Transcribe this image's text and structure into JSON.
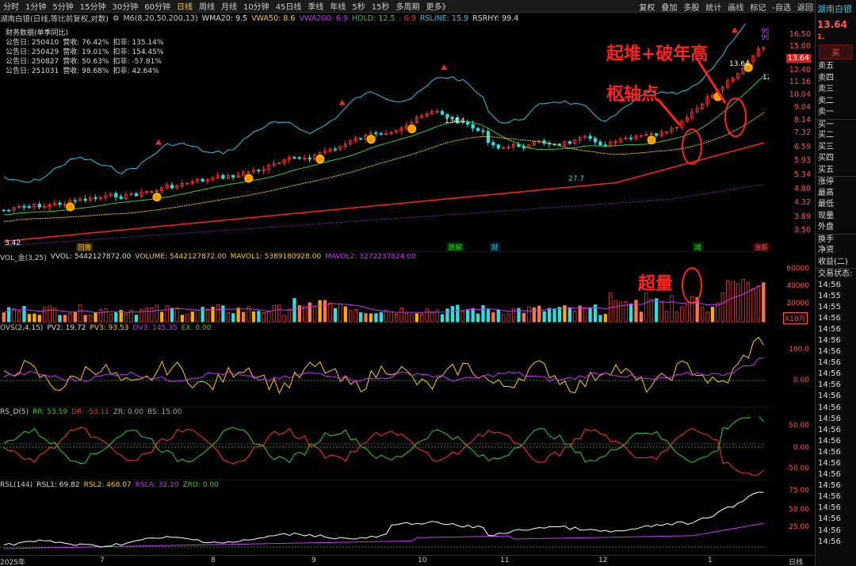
{
  "toolbar": {
    "periods": [
      "分时",
      "1分钟",
      "5分钟",
      "15分钟",
      "30分钟",
      "60分钟",
      "日线",
      "周线",
      "月线",
      "10分钟",
      "45日线",
      "季线",
      "年线",
      "5秒",
      "15秒",
      "多周期",
      "更多》"
    ],
    "active_period": "日线",
    "right_items": [
      "复权",
      "叠加",
      "多股",
      "统计",
      "画线",
      "标记",
      "-自选",
      "返回"
    ]
  },
  "info_line": {
    "title": "湖南白银(日线,等比前复权,对数)",
    "indicator": "M6(8,20,50,200,13)",
    "wma20": "WMA20: 9.5",
    "vwa50": "VWA50: 8.6",
    "vwa200": "VWA200: 6.9",
    "hold": "HOLD: 12.5",
    "hold_val2": ": 6.9",
    "rsline": "RSLINE: 15.9",
    "rsrhy": "RSRHY: 99.4"
  },
  "financial": {
    "header": "财务数据(单季同比)",
    "rows": [
      {
        "date": "公告日: 250410",
        "rev": "营收: 76.42%",
        "net": "扣非: 135.14%"
      },
      {
        "date": "公告日: 250429",
        "rev": "营收: 19.01%",
        "net": "扣非: 154.45%"
      },
      {
        "date": "公告日: 250827",
        "rev": "营收: 50.63%",
        "net": "扣非: -57.81%"
      },
      {
        "date": "公告日: 251031",
        "rev": "营收: 98.68%",
        "net": "扣非: 42.64%"
      }
    ]
  },
  "price_axis": [
    "16.50",
    "15.00",
    "13.64",
    "12.40",
    "11.16",
    "10.04",
    "9.04",
    "8.14",
    "7.32",
    "6.59",
    "5.93",
    "5.34",
    "4.80",
    "4.32",
    "3.89",
    "3.50"
  ],
  "price_labels": {
    "peak_top": "99.8",
    "peak_second": "99.4",
    "last_price": "13.64",
    "hold_level": "12.5",
    "low_label": "3.42",
    "mid_high": "134.4",
    "mid_low": "27.7"
  },
  "annotations": {
    "breakout": "起堆+破年高",
    "pivot": "枢轴点",
    "volume": "超量"
  },
  "event_tags": [
    "回撤",
    "跌解",
    "财",
    "减",
    "涨薪"
  ],
  "volume_panel": {
    "title": "VOL_金(3,25)",
    "vvol": "VVOL: 5442127872.00",
    "volume": "VOLUME: 5442127872.00",
    "mavol1": "MAVOL1: 5389180928.00",
    "mavol2": "MAVOL2: 3272237824.00",
    "axis": [
      "60000",
      "40000",
      "20000"
    ],
    "unit": "X10万"
  },
  "ovs_panel": {
    "title": "OVS(2,4,15)",
    "pv2": "PV2: 19.72",
    "pv3": "PV3: 93.53",
    "ov3": "OV3: 145.35",
    "ex": "EX: 0.00",
    "axis": [
      "100.0",
      "0.00"
    ]
  },
  "rsd_panel": {
    "title": "RS_D(5)",
    "rr": "RR: 53.59",
    "dr": "DR: -53.11",
    "zr": "ZR: 0.00",
    "bs": "BS: 15.00",
    "axis": [
      "50.00",
      "0.00",
      "-50.00"
    ]
  },
  "rsl_panel": {
    "title": "RSL(144)",
    "rsl1": "RSL1: 69.82",
    "rsl2": "RSL2: 468.07",
    "rsla": "RSLA: 32.10",
    "zro": "ZRO: 0.00",
    "axis": [
      "75.00",
      "50.00",
      "25.00"
    ]
  },
  "x_axis": [
    "2025年",
    "7",
    "8",
    "9",
    "10",
    "11",
    "12",
    "1",
    "日线"
  ],
  "right_panel": {
    "stock_name": "湖南白银",
    "price": "13.64",
    "price_suffix": "1.",
    "buy_label": "买",
    "order_rows": [
      "卖五",
      "卖四",
      "卖三",
      "卖二",
      "卖一",
      "买一",
      "买二",
      "买三",
      "买四",
      "买五",
      "涨停",
      "最高",
      "最低",
      "现量",
      "外盘",
      "换手",
      "净资",
      "收益(二)",
      "交易状态:"
    ],
    "times": [
      "14:56",
      "14:55",
      "14:55",
      "14:56",
      "14:56",
      "14:56",
      "14:56",
      "14:56",
      "14:56",
      "14:56",
      "14:56",
      "14:56",
      "14:56",
      "14:56",
      "14:56",
      "14:56",
      "14:56",
      "14:56",
      "14:56",
      "14:56",
      "14:56",
      "14:56",
      "14:56",
      "14:56"
    ]
  },
  "colors": {
    "up": "#ff3333",
    "down": "#33dddd",
    "yellow": "#ffcc00",
    "purple": "#cc33ff",
    "green": "#33cc33",
    "white": "#ffffff",
    "teal": "#2ec7e6"
  }
}
